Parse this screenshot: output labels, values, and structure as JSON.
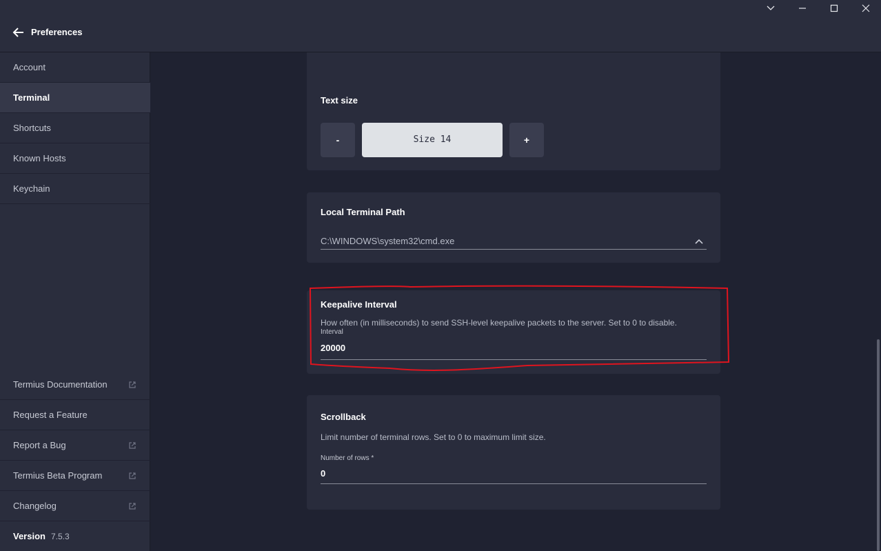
{
  "window": {
    "title": "Preferences",
    "controls": [
      "chevron-down-icon",
      "minimize-icon",
      "maximize-icon",
      "close-icon"
    ]
  },
  "sidebar": {
    "items": [
      {
        "label": "Account",
        "active": false
      },
      {
        "label": "Terminal",
        "active": true
      },
      {
        "label": "Shortcuts",
        "active": false
      },
      {
        "label": "Known Hosts",
        "active": false
      },
      {
        "label": "Keychain",
        "active": false
      }
    ],
    "links": [
      {
        "label": "Termius Documentation",
        "external": true
      },
      {
        "label": "Request a Feature",
        "external": false
      },
      {
        "label": "Report a Bug",
        "external": true
      },
      {
        "label": "Termius Beta Program",
        "external": true
      },
      {
        "label": "Changelog",
        "external": true
      }
    ],
    "version_label": "Version",
    "version_number": "7.5.3"
  },
  "text_size": {
    "title": "Text size",
    "decrease_label": "-",
    "value_label": "Size 14",
    "increase_label": "+"
  },
  "local_terminal": {
    "title": "Local Terminal Path",
    "value": "C:\\WINDOWS\\system32\\cmd.exe"
  },
  "keepalive": {
    "title": "Keepalive Interval",
    "description": "How often (in milliseconds) to send SSH-level keepalive packets to the server. Set to 0 to disable.",
    "field_label": "Interval",
    "value": "20000"
  },
  "scrollback": {
    "title": "Scrollback",
    "description": "Limit number of terminal rows. Set to 0 to maximum limit size.",
    "field_label": "Number of rows *",
    "value": "0"
  },
  "colors": {
    "background": "#1f2231",
    "panel": "#2a2d3d",
    "card": "#292c3c",
    "highlight": "#e0141e"
  }
}
